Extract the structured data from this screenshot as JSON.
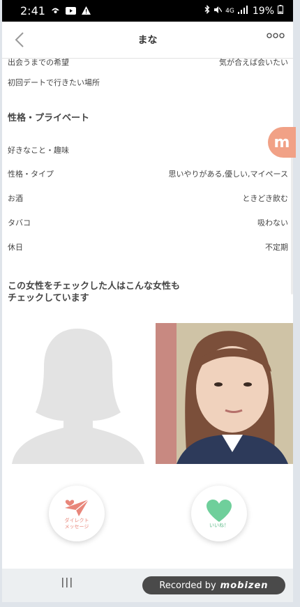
{
  "status_bar": {
    "time": "2:41",
    "network": "4G",
    "battery": "19%"
  },
  "header": {
    "title": "まな",
    "back_glyph": "<",
    "more_glyph": "ooo"
  },
  "profile_rows_top": [
    {
      "label": "出会うまでの希望",
      "value": "気が合えば会いたい"
    },
    {
      "label": "初回デートで行きたい場所",
      "value": ""
    }
  ],
  "section_personality": {
    "title": "性格・プライベート",
    "rows": [
      {
        "label": "好きなこと・趣味",
        "value": ""
      },
      {
        "label": "性格・タイプ",
        "value": "思いやりがある,優しい,マイペース"
      },
      {
        "label": "お酒",
        "value": "ときどき飲む"
      },
      {
        "label": "タバコ",
        "value": "吸わない"
      },
      {
        "label": "休日",
        "value": "不定期"
      }
    ]
  },
  "also_checked": {
    "title_line1": "この女性をチェックした人はこんな女性も",
    "title_line2": "チェックしています"
  },
  "actions": {
    "message_label_line1": "ダイレクト",
    "message_label_line2": "メッセージ",
    "like_label": "いいね！"
  },
  "side_badge": "m",
  "watermark": {
    "text": "Recorded by",
    "brand": "mobizen"
  },
  "colors": {
    "accent_pink": "#e8867a",
    "like_green": "#6fcf9b",
    "badge": "#f1a186"
  }
}
